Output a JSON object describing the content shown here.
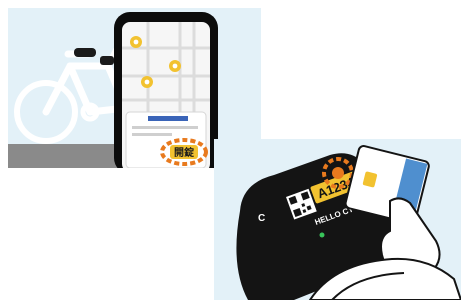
{
  "top_panel": {
    "unlock_button_label": "開錠"
  },
  "bottom_panel": {
    "plate_code": "A1234",
    "brand_name": "HELLO CYCLING",
    "side_letter": "C"
  },
  "colors": {
    "background_light_blue": "#e3f1f8",
    "phone_frame": "#0c0c0c",
    "bike_white": "#ffffff",
    "map_pin_yellow": "#f2c230",
    "button_yellow": "#f2c230",
    "highlight_orange": "#e87a1e",
    "lock_body_black": "#141414",
    "card_blue": "#4f8fcf",
    "ground_gray": "#8a8a8a"
  }
}
